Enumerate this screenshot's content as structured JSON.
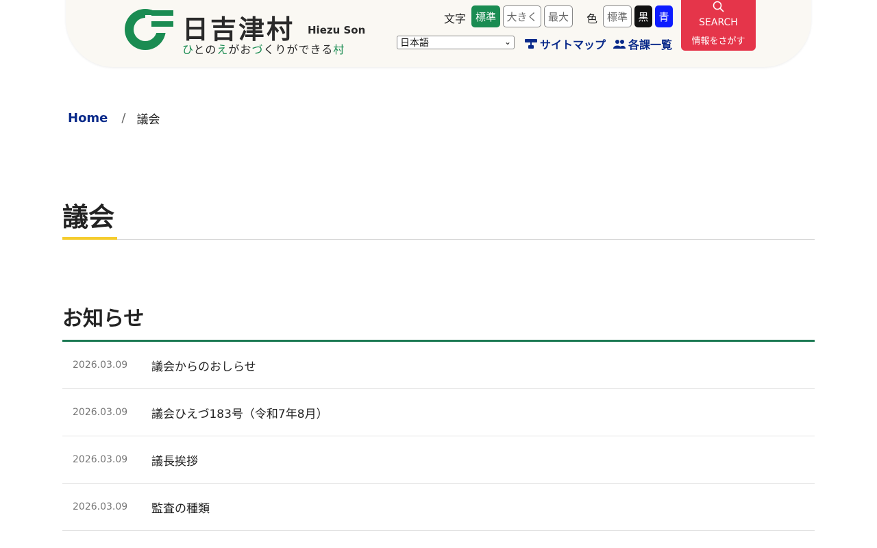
{
  "header": {
    "logo_title": "日吉津村",
    "logo_en": "Hiezu Son",
    "tagline_parts": [
      "ひ",
      "と",
      "の",
      "え",
      "が",
      "お",
      "づ",
      "く",
      "り",
      "が",
      "で",
      "き",
      "る",
      "村"
    ],
    "font_size_label": "文字",
    "font_size_buttons": [
      "標準",
      "大きく",
      "最大"
    ],
    "color_label": "色",
    "color_buttons": [
      "標準",
      "黒",
      "青"
    ],
    "language_value": "日本語",
    "sitemap_label": "サイトマップ",
    "departments_label": "各課一覧",
    "search_label": "SEARCH",
    "search_sublabel": "情報をさがす",
    "brand_color": "#1a8c52",
    "search_color": "#e5354a"
  },
  "breadcrumb": {
    "home": "Home",
    "separator": "/",
    "current": "議会"
  },
  "page": {
    "title": "議会"
  },
  "news": {
    "title": "お知らせ",
    "items": [
      {
        "date": "2026.03.09",
        "title": "議会からのおしらせ"
      },
      {
        "date": "2026.03.09",
        "title": "議会ひえづ183号（令和7年8月）"
      },
      {
        "date": "2026.03.09",
        "title": "議長挨拶"
      },
      {
        "date": "2026.03.09",
        "title": "監査の種類"
      }
    ]
  }
}
